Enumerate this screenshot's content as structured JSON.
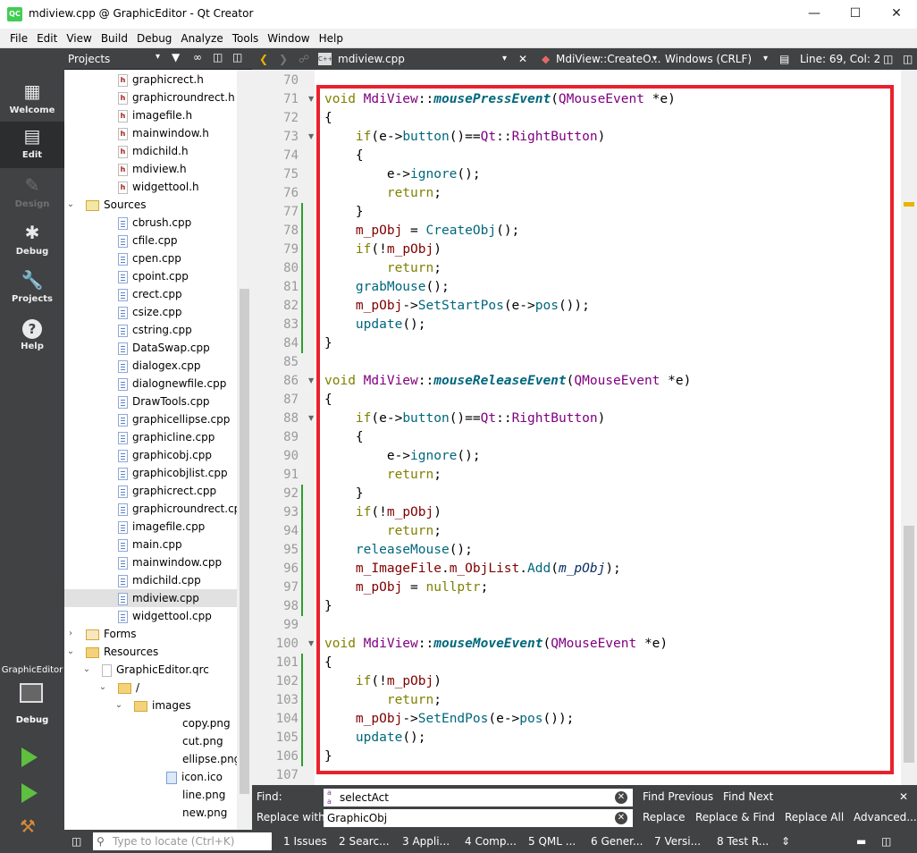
{
  "window": {
    "title": "mdiview.cpp @ GraphicEditor - Qt Creator",
    "app_icon": "QC"
  },
  "menu": [
    "File",
    "Edit",
    "View",
    "Build",
    "Debug",
    "Analyze",
    "Tools",
    "Window",
    "Help"
  ],
  "modes": [
    {
      "label": "Welcome",
      "icon": "grid-icon",
      "state": "normal"
    },
    {
      "label": "Edit",
      "icon": "edit-icon",
      "state": "selected"
    },
    {
      "label": "Design",
      "icon": "pencil-icon",
      "state": "disabled"
    },
    {
      "label": "Debug",
      "icon": "bug-icon",
      "state": "normal"
    },
    {
      "label": "Projects",
      "icon": "wrench-icon",
      "state": "normal"
    },
    {
      "label": "Help",
      "icon": "help-icon",
      "state": "normal"
    }
  ],
  "kit": {
    "project": "GraphicEditor",
    "config": "Debug"
  },
  "projects_panel": {
    "title": "Projects"
  },
  "tree": [
    {
      "label": "graphicrect.h",
      "type": "h",
      "indent": 3
    },
    {
      "label": "graphicroundrect.h",
      "type": "h",
      "indent": 3
    },
    {
      "label": "imagefile.h",
      "type": "h",
      "indent": 3
    },
    {
      "label": "mainwindow.h",
      "type": "h",
      "indent": 3
    },
    {
      "label": "mdichild.h",
      "type": "h",
      "indent": 3
    },
    {
      "label": "mdiview.h",
      "type": "h",
      "indent": 3
    },
    {
      "label": "widgettool.h",
      "type": "h",
      "indent": 3
    },
    {
      "label": "Sources",
      "type": "srcfolder",
      "indent": 1,
      "arrow": "⌄"
    },
    {
      "label": "cbrush.cpp",
      "type": "cpp",
      "indent": 3
    },
    {
      "label": "cfile.cpp",
      "type": "cpp",
      "indent": 3
    },
    {
      "label": "cpen.cpp",
      "type": "cpp",
      "indent": 3
    },
    {
      "label": "cpoint.cpp",
      "type": "cpp",
      "indent": 3
    },
    {
      "label": "crect.cpp",
      "type": "cpp",
      "indent": 3
    },
    {
      "label": "csize.cpp",
      "type": "cpp",
      "indent": 3
    },
    {
      "label": "cstring.cpp",
      "type": "cpp",
      "indent": 3
    },
    {
      "label": "DataSwap.cpp",
      "type": "cpp",
      "indent": 3
    },
    {
      "label": "dialogex.cpp",
      "type": "cpp",
      "indent": 3
    },
    {
      "label": "dialognewfile.cpp",
      "type": "cpp",
      "indent": 3
    },
    {
      "label": "DrawTools.cpp",
      "type": "cpp",
      "indent": 3
    },
    {
      "label": "graphicellipse.cpp",
      "type": "cpp",
      "indent": 3
    },
    {
      "label": "graphicline.cpp",
      "type": "cpp",
      "indent": 3
    },
    {
      "label": "graphicobj.cpp",
      "type": "cpp",
      "indent": 3
    },
    {
      "label": "graphicobjlist.cpp",
      "type": "cpp",
      "indent": 3
    },
    {
      "label": "graphicrect.cpp",
      "type": "cpp",
      "indent": 3
    },
    {
      "label": "graphicroundrect.cpp",
      "type": "cpp",
      "indent": 3
    },
    {
      "label": "imagefile.cpp",
      "type": "cpp",
      "indent": 3
    },
    {
      "label": "main.cpp",
      "type": "cpp",
      "indent": 3
    },
    {
      "label": "mainwindow.cpp",
      "type": "cpp",
      "indent": 3
    },
    {
      "label": "mdichild.cpp",
      "type": "cpp",
      "indent": 3
    },
    {
      "label": "mdiview.cpp",
      "type": "cpp",
      "indent": 3,
      "selected": true
    },
    {
      "label": "widgettool.cpp",
      "type": "cpp",
      "indent": 3
    },
    {
      "label": "Forms",
      "type": "formfolder",
      "indent": 1,
      "arrow": "›"
    },
    {
      "label": "Resources",
      "type": "resfolder",
      "indent": 1,
      "arrow": "⌄"
    },
    {
      "label": "GraphicEditor.qrc",
      "type": "qrc",
      "indent": 2,
      "arrow": "⌄"
    },
    {
      "label": "/",
      "type": "folder",
      "indent": 3,
      "arrow": "⌄"
    },
    {
      "label": "images",
      "type": "folder",
      "indent": 4,
      "arrow": "⌄"
    },
    {
      "label": "copy.png",
      "type": "img",
      "indent": 6
    },
    {
      "label": "cut.png",
      "type": "img",
      "indent": 6
    },
    {
      "label": "ellipse.png",
      "type": "img",
      "indent": 6
    },
    {
      "label": "icon.ico",
      "type": "ico",
      "indent": 5
    },
    {
      "label": "line.png",
      "type": "img",
      "indent": 6
    },
    {
      "label": "new.png",
      "type": "img",
      "indent": 6
    }
  ],
  "editor_toolbar": {
    "file": "mdiview.cpp",
    "symbol": "MdiView::CreateO...",
    "line_endings": "Windows (CRLF)",
    "position": "Line: 69, Col: 2"
  },
  "code": {
    "first_line": 70,
    "lines": [
      [],
      [
        [
          "kw",
          "void "
        ],
        [
          "ty",
          "MdiView"
        ],
        [
          "",
          "::"
        ],
        [
          "fd",
          "mousePressEvent"
        ],
        [
          "",
          "("
        ],
        [
          "ty",
          "QMouseEvent"
        ],
        [
          "",
          " *e)"
        ]
      ],
      [
        [
          "",
          "{"
        ]
      ],
      [
        [
          "",
          "    "
        ],
        [
          "kw",
          "if"
        ],
        [
          "",
          "(e->"
        ],
        [
          "fn",
          "button"
        ],
        [
          "",
          "()=="
        ],
        [
          "ty",
          "Qt"
        ],
        [
          "",
          "::"
        ],
        [
          "ty",
          "RightButton"
        ],
        [
          "",
          ")"
        ]
      ],
      [
        [
          "",
          "    {"
        ]
      ],
      [
        [
          "",
          "        e->"
        ],
        [
          "fn",
          "ignore"
        ],
        [
          "",
          "();"
        ]
      ],
      [
        [
          "",
          "        "
        ],
        [
          "kw",
          "return"
        ],
        [
          "",
          ";"
        ]
      ],
      [
        [
          "",
          "    }"
        ]
      ],
      [
        [
          "",
          "    "
        ],
        [
          "mv",
          "m_pObj"
        ],
        [
          "",
          " = "
        ],
        [
          "fn",
          "CreateObj"
        ],
        [
          "",
          "();"
        ]
      ],
      [
        [
          "",
          "    "
        ],
        [
          "kw",
          "if"
        ],
        [
          "",
          "(!"
        ],
        [
          "mv",
          "m_pObj"
        ],
        [
          "",
          ")"
        ]
      ],
      [
        [
          "",
          "        "
        ],
        [
          "kw",
          "return"
        ],
        [
          "",
          ";"
        ]
      ],
      [
        [
          "",
          "    "
        ],
        [
          "fn",
          "grabMouse"
        ],
        [
          "",
          "();"
        ]
      ],
      [
        [
          "",
          "    "
        ],
        [
          "mv",
          "m_pObj"
        ],
        [
          "",
          "->"
        ],
        [
          "fn",
          "SetStartPos"
        ],
        [
          "",
          "(e->"
        ],
        [
          "fn",
          "pos"
        ],
        [
          "",
          "());"
        ]
      ],
      [
        [
          "",
          "    "
        ],
        [
          "fn",
          "update"
        ],
        [
          "",
          "();"
        ]
      ],
      [
        [
          "",
          "}"
        ]
      ],
      [],
      [
        [
          "kw",
          "void "
        ],
        [
          "ty",
          "MdiView"
        ],
        [
          "",
          "::"
        ],
        [
          "fd",
          "mouseReleaseEvent"
        ],
        [
          "",
          "("
        ],
        [
          "ty",
          "QMouseEvent"
        ],
        [
          "",
          " *e)"
        ]
      ],
      [
        [
          "",
          "{"
        ]
      ],
      [
        [
          "",
          "    "
        ],
        [
          "kw",
          "if"
        ],
        [
          "",
          "(e->"
        ],
        [
          "fn",
          "button"
        ],
        [
          "",
          "()=="
        ],
        [
          "ty",
          "Qt"
        ],
        [
          "",
          "::"
        ],
        [
          "ty",
          "RightButton"
        ],
        [
          "",
          ")"
        ]
      ],
      [
        [
          "",
          "    {"
        ]
      ],
      [
        [
          "",
          "        e->"
        ],
        [
          "fn",
          "ignore"
        ],
        [
          "",
          "();"
        ]
      ],
      [
        [
          "",
          "        "
        ],
        [
          "kw",
          "return"
        ],
        [
          "",
          ";"
        ]
      ],
      [
        [
          "",
          "    }"
        ]
      ],
      [
        [
          "",
          "    "
        ],
        [
          "kw",
          "if"
        ],
        [
          "",
          "(!"
        ],
        [
          "mv",
          "m_pObj"
        ],
        [
          "",
          ")"
        ]
      ],
      [
        [
          "",
          "        "
        ],
        [
          "kw",
          "return"
        ],
        [
          "",
          ";"
        ]
      ],
      [
        [
          "",
          "    "
        ],
        [
          "fn",
          "releaseMouse"
        ],
        [
          "",
          "();"
        ]
      ],
      [
        [
          "",
          "    "
        ],
        [
          "mv",
          "m_ImageFile"
        ],
        [
          "",
          "."
        ],
        [
          "mv",
          "m_ObjList"
        ],
        [
          "",
          "."
        ],
        [
          "fn",
          "Add"
        ],
        [
          "",
          "("
        ],
        [
          "pm",
          "m_pObj"
        ],
        [
          "",
          ");"
        ]
      ],
      [
        [
          "",
          "    "
        ],
        [
          "mv",
          "m_pObj"
        ],
        [
          "",
          " = "
        ],
        [
          "kw",
          "nullptr"
        ],
        [
          "",
          ";"
        ]
      ],
      [
        [
          "",
          "}"
        ]
      ],
      [],
      [
        [
          "kw",
          "void "
        ],
        [
          "ty",
          "MdiView"
        ],
        [
          "",
          "::"
        ],
        [
          "fd",
          "mouseMoveEvent"
        ],
        [
          "",
          "("
        ],
        [
          "ty",
          "QMouseEvent"
        ],
        [
          "",
          " *e)"
        ]
      ],
      [
        [
          "",
          "{"
        ]
      ],
      [
        [
          "",
          "    "
        ],
        [
          "kw",
          "if"
        ],
        [
          "",
          "(!"
        ],
        [
          "mv",
          "m_pObj"
        ],
        [
          "",
          ")"
        ]
      ],
      [
        [
          "",
          "        "
        ],
        [
          "kw",
          "return"
        ],
        [
          "",
          ";"
        ]
      ],
      [
        [
          "",
          "    "
        ],
        [
          "mv",
          "m_pObj"
        ],
        [
          "",
          "->"
        ],
        [
          "fn",
          "SetEndPos"
        ],
        [
          "",
          "(e->"
        ],
        [
          "fn",
          "pos"
        ],
        [
          "",
          "());"
        ]
      ],
      [
        [
          "",
          "    "
        ],
        [
          "fn",
          "update"
        ],
        [
          "",
          "();"
        ]
      ],
      [
        [
          "",
          "}"
        ]
      ],
      []
    ]
  },
  "find": {
    "find_label": "Find:",
    "find_value": "selectAct",
    "replace_label": "Replace with:",
    "replace_value": "GraphicObj",
    "find_prev": "Find Previous",
    "find_next": "Find Next",
    "replace": "Replace",
    "replace_find": "Replace & Find",
    "replace_all": "Replace All",
    "advanced": "Advanced..."
  },
  "status": {
    "locate_placeholder": "Type to locate (Ctrl+K)",
    "tabs": [
      "1 Issues",
      "2 Searc...",
      "3 Appli...",
      "4 Comp...",
      "5 QML ...",
      "6 Gener...",
      "7 Versi...",
      "8 Test R..."
    ]
  },
  "colors": {
    "highlight_box": "#e8222d",
    "dark_panel": "#404244"
  }
}
